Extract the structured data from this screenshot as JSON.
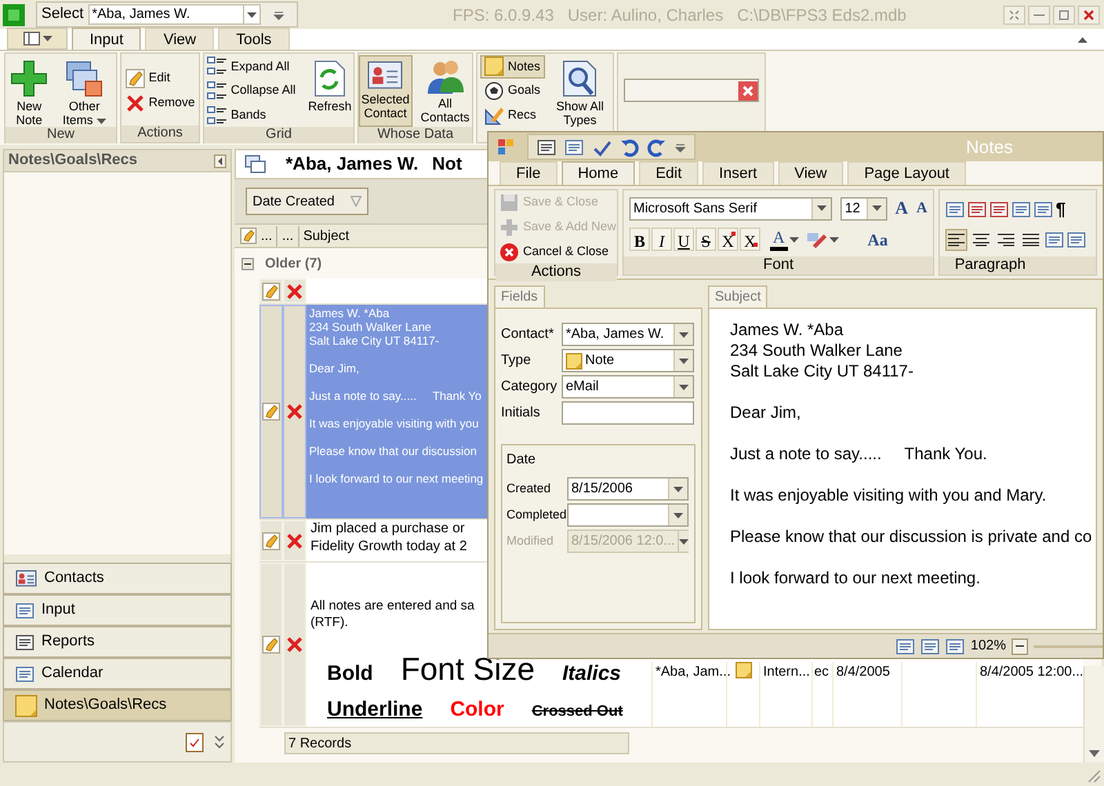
{
  "app_bar": {
    "select_label": "Select",
    "select_value": "*Aba, James W.",
    "title": "FPS: 6.0.9.43   User: Aulino, Charles   C:\\DB\\FPS3 Eds2.mdb"
  },
  "ribbon": {
    "tabs": [
      {
        "label": "Input",
        "selected": true
      },
      {
        "label": "View",
        "selected": false
      },
      {
        "label": "Tools",
        "selected": false
      }
    ],
    "groups": [
      {
        "label": "New",
        "items": [
          {
            "kind": "large",
            "label": "New Note"
          },
          {
            "kind": "large",
            "label": "Other Items",
            "dropdown": true
          }
        ]
      },
      {
        "label": "Actions",
        "items": [
          {
            "kind": "small",
            "label": "Edit"
          },
          {
            "kind": "small",
            "label": "Remove"
          }
        ]
      },
      {
        "label": "Grid",
        "items": [
          {
            "kind": "small",
            "label": "Expand All"
          },
          {
            "kind": "small",
            "label": "Collapse All"
          },
          {
            "kind": "small",
            "label": "Bands"
          },
          {
            "kind": "large",
            "label": "Refresh"
          }
        ]
      },
      {
        "label": "Whose Data",
        "items": [
          {
            "kind": "large",
            "label": "Selected Contact",
            "selected": true
          },
          {
            "kind": "large",
            "label": "All Contacts",
            "selected": false
          }
        ]
      },
      {
        "items": [
          {
            "kind": "small",
            "label": "Notes",
            "selected": true
          },
          {
            "kind": "small",
            "label": "Goals",
            "selected": false
          },
          {
            "kind": "small",
            "label": "Recs",
            "selected": false
          },
          {
            "kind": "large",
            "label": "Show All Types",
            "selected": false
          }
        ]
      }
    ]
  },
  "sidebar": {
    "title": "Notes\\Goals\\Recs",
    "items": [
      {
        "label": "Contacts",
        "selected": false
      },
      {
        "label": "Input",
        "selected": false
      },
      {
        "label": "Reports",
        "selected": false
      },
      {
        "label": "Calendar",
        "selected": false
      },
      {
        "label": "Notes\\Goals\\Recs",
        "selected": true
      }
    ]
  },
  "main": {
    "title": "*Aba, James W.",
    "title_2": "Not",
    "group_by": "Date Created",
    "columns": [
      "...",
      "...",
      "Subject"
    ],
    "group": {
      "label": "Older (7)",
      "expanded": true
    },
    "rows": [
      {
        "kind": "empty",
        "selected": false
      },
      {
        "kind": "preview",
        "selected": true,
        "paragraphs": [
          [
            "James W. *Aba",
            "234 South Walker Lane",
            "Salt Lake City UT 84117-"
          ],
          [
            "Dear Jim,"
          ],
          [
            "Just a note to say.....     Thank Yo"
          ],
          [
            "It was enjoyable visiting with you"
          ],
          [
            "Please know that our discussion"
          ],
          [
            "I look forward to our next meeting"
          ]
        ]
      },
      {
        "kind": "text",
        "selected": false,
        "lines": [
          "Jim placed a purchase or",
          "Fidelity Growth today at 2"
        ]
      },
      {
        "kind": "formatted",
        "selected": false,
        "lines": [
          "All notes are entered and sa",
          "(RTF)."
        ],
        "samples": [
          [
            {
              "text": "Bold",
              "kind": "bold"
            },
            {
              "text": "Font Size",
              "kind": "large"
            },
            {
              "text": "Italics",
              "kind": "italic"
            }
          ],
          [
            {
              "text": "Underline",
              "kind": "underline"
            },
            {
              "text": "Color",
              "kind": "color",
              "color": "#ff0000"
            },
            {
              "text": "Crossed Out",
              "kind": "strike"
            }
          ]
        ],
        "contact": "*Aba, Jam...",
        "category": "Intern...",
        "column_4": "ec",
        "created": "8/4/2005",
        "modified": "8/4/2005 12:00..."
      }
    ],
    "footer": "7 Records"
  },
  "notes_window": {
    "title": "Notes",
    "tabs": [
      {
        "label": "File",
        "selected": false
      },
      {
        "label": "Home",
        "selected": true
      },
      {
        "label": "Edit",
        "selected": false
      },
      {
        "label": "Insert",
        "selected": false
      },
      {
        "label": "View",
        "selected": false
      },
      {
        "label": "Page Layout",
        "selected": false
      }
    ],
    "actions": {
      "label": "Actions",
      "items": [
        {
          "label": "Save & Close",
          "disabled": true
        },
        {
          "label": "Save & Add New",
          "disabled": true
        },
        {
          "label": "Cancel & Close",
          "disabled": false
        }
      ]
    },
    "font": {
      "label": "Font",
      "name": "Microsoft Sans Serif",
      "size": "12",
      "grow": "A",
      "shrink": "A",
      "case": "Aa",
      "color_glyph": "A",
      "styles": [
        {
          "glyph": "B",
          "kind": "bold"
        },
        {
          "glyph": "I",
          "kind": "italic"
        },
        {
          "glyph": "U",
          "kind": "underline"
        },
        {
          "glyph": "S",
          "kind": "strike"
        },
        {
          "glyph": "X",
          "kind": "superscript"
        },
        {
          "glyph": "X",
          "kind": "subscript"
        }
      ]
    },
    "paragraph": {
      "label": "Paragraph",
      "pilcrow": "¶",
      "align": [
        {
          "selected": true
        },
        {
          "selected": false
        },
        {
          "selected": false
        },
        {
          "selected": false
        }
      ]
    },
    "fields": {
      "tab": "Fields",
      "items": [
        {
          "label": "Contact*",
          "value": "*Aba, James W.",
          "kind": "combo"
        },
        {
          "label": "Type",
          "value": "Note",
          "kind": "combo_icon"
        },
        {
          "label": "Category",
          "value": "eMail",
          "kind": "combo"
        },
        {
          "label": "Initials",
          "kind": "text"
        }
      ],
      "date": {
        "title": "Date",
        "items": [
          {
            "label": "Created",
            "value": "8/15/2006",
            "disabled": false
          },
          {
            "label": "Completed",
            "disabled": false
          },
          {
            "label": "Modified",
            "value": "8/15/2006 12:0...",
            "disabled": true
          }
        ]
      }
    },
    "editor": {
      "tab": "Subject",
      "paragraphs": [
        [
          "James W. *Aba",
          "234 South Walker Lane",
          "Salt Lake City UT 84117-"
        ],
        [
          "Dear Jim,"
        ],
        [
          "Just a note to say.....     Thank You."
        ],
        [
          "It was enjoyable visiting with you and Mary."
        ],
        [
          "Please know that our discussion is private and co"
        ],
        [
          "I look forward to our next meeting."
        ]
      ]
    },
    "status": {
      "zoom": "102%"
    }
  }
}
